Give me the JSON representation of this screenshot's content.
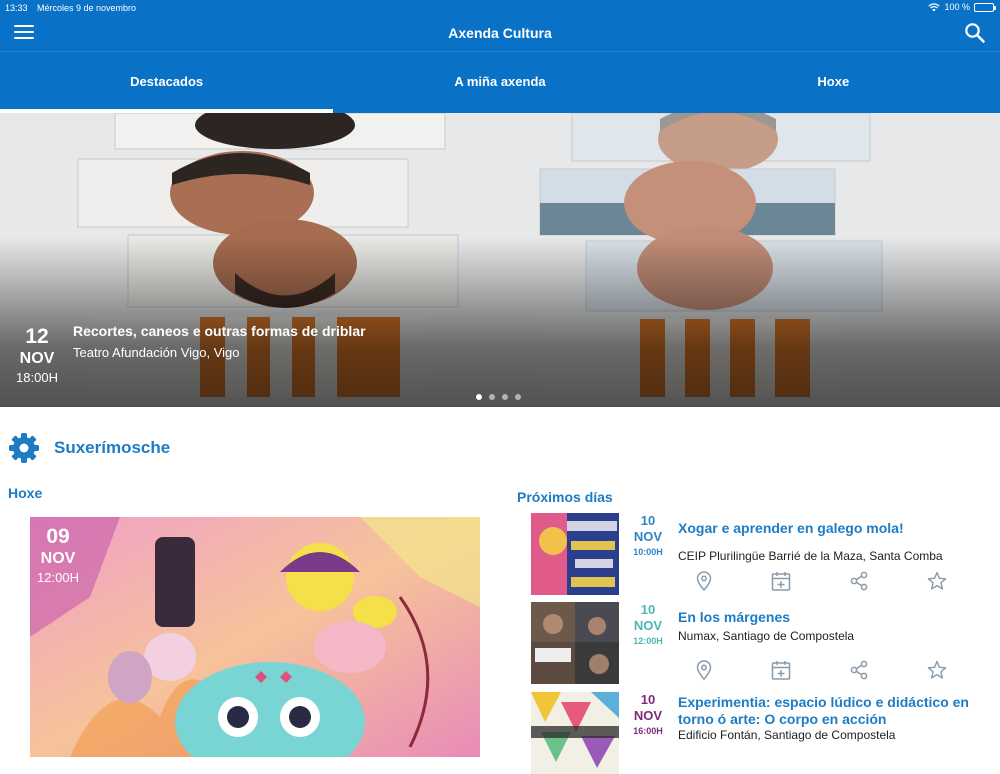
{
  "status_bar": {
    "time": "13:33",
    "date": "Mércoles 9 de novembro",
    "battery": "100 %"
  },
  "app": {
    "title": "Axenda Cultura",
    "menu_icon": "menu-icon",
    "search_icon": "search-icon"
  },
  "tabs": [
    {
      "label": "Destacados",
      "active": true
    },
    {
      "label": "A miña axenda",
      "active": false
    },
    {
      "label": "Hoxe",
      "active": false
    }
  ],
  "featured": {
    "day": "12",
    "month": "NOV",
    "time": "18:00H",
    "title": "Recortes, caneos e outras formas de driblar",
    "venue": "Teatro Afundación Vigo, Vigo",
    "carousel_pages": 4,
    "carousel_active": 1
  },
  "suggestions": {
    "title": "Suxerímosche",
    "icon": "gear-icon",
    "today": {
      "label": "Hoxe",
      "event": {
        "day": "09",
        "month": "NOV",
        "time": "12:00H"
      }
    },
    "upcoming": {
      "label": "Próximos días",
      "events": [
        {
          "day": "10",
          "month": "NOV",
          "time": "10:00H",
          "title": "Xogar e aprender en galego mola!",
          "venue": "CEIP Plurilingüe Barrié de la Maza, Santa Comba",
          "date_color": "#2a86c8"
        },
        {
          "day": "10",
          "month": "NOV",
          "time": "12:00H",
          "title": "En los márgenes",
          "venue": "Numax, Santiago de Compostela",
          "date_color": "#4cb8b2"
        },
        {
          "day": "10",
          "month": "NOV",
          "time": "16:00H",
          "title": "Experimentia: espacio lúdico e didáctico en torno ó arte: O corpo en acción",
          "venue": "Edificio Fontán, Santiago de Compostela",
          "date_color": "#7d2a7c"
        }
      ],
      "action_icons": [
        "map-pin-icon",
        "calendar-add-icon",
        "share-icon",
        "star-icon"
      ]
    }
  },
  "colors": {
    "primary": "#0a72c6",
    "accent": "#1d7cc4"
  }
}
